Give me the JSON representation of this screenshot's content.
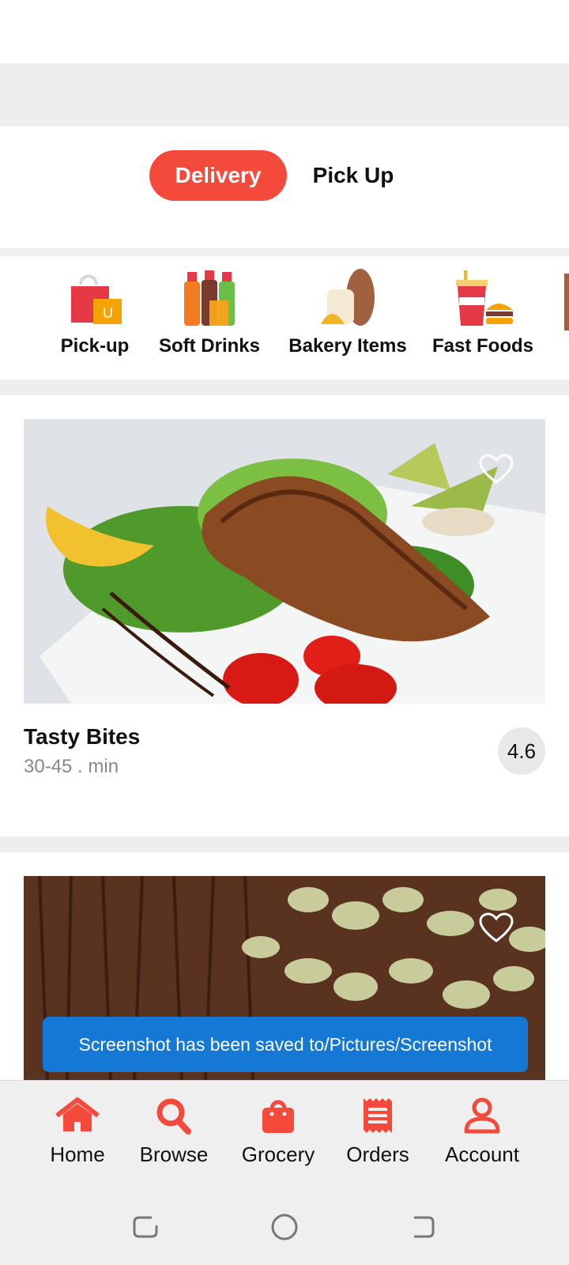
{
  "order_mode": {
    "options": [
      "Delivery",
      "Pick Up"
    ],
    "selected": "Delivery"
  },
  "categories": [
    {
      "label": "Pick-up",
      "icon": "shopping-bags-icon"
    },
    {
      "label": "Soft Drinks",
      "icon": "soft-drinks-icon"
    },
    {
      "label": "Bakery Items",
      "icon": "bakery-icon"
    },
    {
      "label": "Fast Foods",
      "icon": "fast-food-icon"
    }
  ],
  "restaurants": [
    {
      "name": "Tasty Bites",
      "time": "30-45 . min",
      "rating": "4.6",
      "favorite_icon": "heart-outline-icon"
    },
    {
      "favorite_icon": "heart-outline-icon"
    }
  ],
  "toast": "Screenshot has been saved to/Pictures/Screenshot",
  "bottom_nav": [
    {
      "label": "Home",
      "icon": "home-icon"
    },
    {
      "label": "Browse",
      "icon": "search-icon"
    },
    {
      "label": "Grocery",
      "icon": "shopping-bag-icon"
    },
    {
      "label": "Orders",
      "icon": "receipt-icon"
    },
    {
      "label": "Account",
      "icon": "account-icon"
    }
  ],
  "colors": {
    "accent": "#f44a3c",
    "toast": "#1478d4",
    "nav_bg": "#efefef"
  }
}
